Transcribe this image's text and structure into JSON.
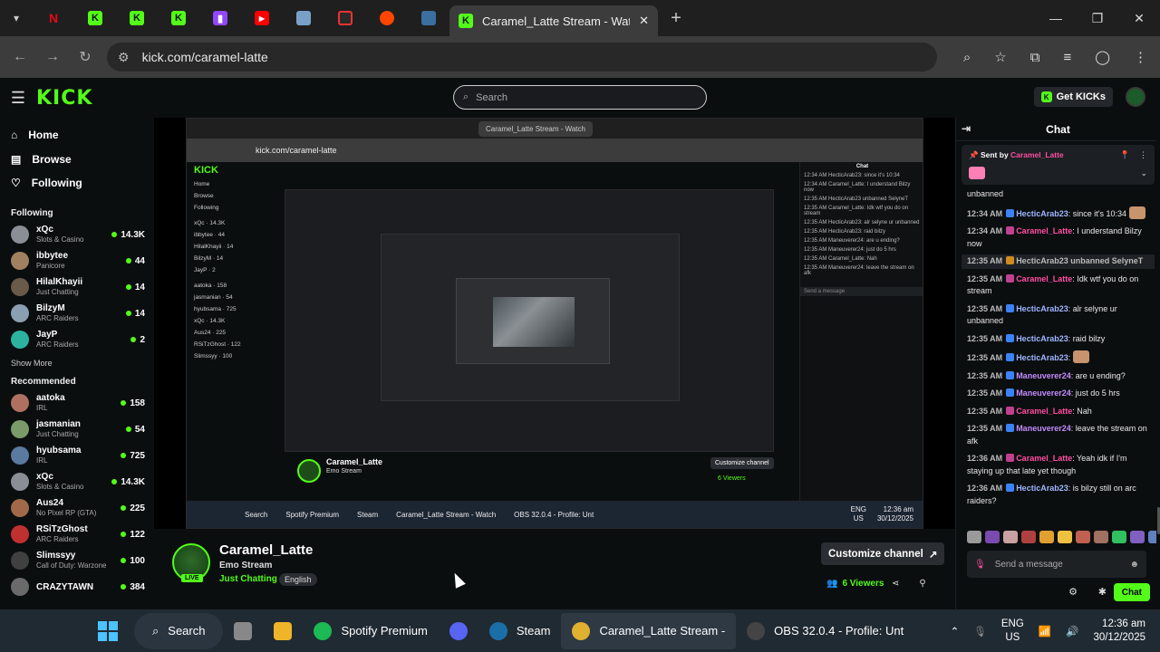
{
  "browser": {
    "active_tab_title": "Caramel_Latte Stream - Watch",
    "address": "kick.com/caramel-latte",
    "pinned_tab_icons": [
      "netflix-icon",
      "kick-icon",
      "kick-icon",
      "kick-icon",
      "twitch-icon",
      "youtube-icon",
      "site-icon",
      "site-icon",
      "reddit-icon",
      "site-icon"
    ]
  },
  "header": {
    "logo": "KICK",
    "search_placeholder": "Search",
    "get_kicks": "Get KICKs"
  },
  "sidebar": {
    "nav": [
      {
        "label": "Home",
        "icon": "home-icon"
      },
      {
        "label": "Browse",
        "icon": "compass-icon"
      },
      {
        "label": "Following",
        "icon": "heart-icon"
      }
    ],
    "following_heading": "Following",
    "following": [
      {
        "name": "xQc",
        "category": "Slots & Casino",
        "viewers": "14.3K",
        "color": "#8a8f96"
      },
      {
        "name": "ibbytee",
        "category": "Panicore",
        "viewers": "44",
        "color": "#a08060"
      },
      {
        "name": "HilalKhayii",
        "category": "Just Chatting",
        "viewers": "14",
        "color": "#6a5a4a"
      },
      {
        "name": "BilzyM",
        "category": "ARC Raiders",
        "viewers": "14",
        "color": "#8aa0b0"
      },
      {
        "name": "JayP",
        "category": "ARC Raiders",
        "viewers": "2",
        "color": "#2bb3a0"
      }
    ],
    "show_more": "Show More",
    "recommended_heading": "Recommended",
    "recommended": [
      {
        "name": "aatoka",
        "category": "IRL",
        "viewers": "158",
        "color": "#b07060"
      },
      {
        "name": "jasmanian",
        "category": "Just Chatting",
        "viewers": "54",
        "color": "#7a9a6a"
      },
      {
        "name": "hyubsama",
        "category": "IRL",
        "viewers": "725",
        "color": "#5a7aa0"
      },
      {
        "name": "xQc",
        "category": "Slots & Casino",
        "viewers": "14.3K",
        "color": "#8a8f96"
      },
      {
        "name": "Aus24",
        "category": "No Pixel RP (GTA)",
        "viewers": "225",
        "color": "#a06a4a"
      },
      {
        "name": "RSiTzGhost",
        "category": "ARC Raiders",
        "viewers": "122",
        "color": "#c03030"
      },
      {
        "name": "Slimssyy",
        "category": "Call of Duty: Warzone",
        "viewers": "100",
        "color": "#404040"
      },
      {
        "name": "CRAZYTAWN",
        "category": "",
        "viewers": "384",
        "color": "#6a6a6a"
      }
    ]
  },
  "stream": {
    "channel": "Caramel_Latte",
    "title": "Emo Stream",
    "category": "Just Chatting",
    "tag": "English",
    "live": "LIVE",
    "customize": "Customize channel",
    "viewers": "6 Viewers"
  },
  "inner": {
    "address": "kick.com/caramel-latte",
    "tab_title": "Caramel_Latte Stream - Watch",
    "channel": "Caramel_Latte",
    "title": "Emo Stream",
    "customize": "Customize channel",
    "chat_placeholder": "Send a message",
    "viewers": "6 Viewers",
    "taskbar": [
      "Search",
      "Spotify Premium",
      "Steam",
      "Caramel_Latte Stream - Watch",
      "OBS 32.0.4 - Profile: Unt"
    ],
    "clock_time": "12:36 am",
    "clock_date": "30/12/2025",
    "lang_top": "ENG",
    "lang_bottom": "US"
  },
  "chat": {
    "title": "Chat",
    "pinned_label": "Sent by",
    "pinned_user": "Caramel_Latte",
    "top_fragment": "unbanned",
    "messages": [
      {
        "ts": "12:34 AM",
        "user": "HecticArab23",
        "color": "#9fb6ff",
        "text": ": since it's 10:34",
        "emote": true,
        "sys": false
      },
      {
        "ts": "12:34 AM",
        "user": "Caramel_Latte",
        "color": "#ff4fa3",
        "text": ": I understand Bilzy now",
        "emote": false,
        "sys": false
      },
      {
        "ts": "12:35 AM",
        "user": "HecticArab23",
        "color": "#bbbbbb",
        "text": " unbanned SelyneT",
        "emote": false,
        "sys": true
      },
      {
        "ts": "12:35 AM",
        "user": "Caramel_Latte",
        "color": "#ff4fa3",
        "text": ": Idk wtf you do on stream",
        "emote": false,
        "sys": false
      },
      {
        "ts": "12:35 AM",
        "user": "HecticArab23",
        "color": "#9fb6ff",
        "text": ": alr selyne ur unbanned",
        "emote": false,
        "sys": false
      },
      {
        "ts": "12:35 AM",
        "user": "HecticArab23",
        "color": "#9fb6ff",
        "text": ": raid bilzy",
        "emote": false,
        "sys": false
      },
      {
        "ts": "12:35 AM",
        "user": "HecticArab23",
        "color": "#9fb6ff",
        "text": ":",
        "emote": true,
        "sys": false
      },
      {
        "ts": "12:35 AM",
        "user": "Maneuverer24",
        "color": "#c48cff",
        "text": ": are u ending?",
        "emote": false,
        "sys": false
      },
      {
        "ts": "12:35 AM",
        "user": "Maneuverer24",
        "color": "#c48cff",
        "text": ": just do 5 hrs",
        "emote": false,
        "sys": false
      },
      {
        "ts": "12:35 AM",
        "user": "Caramel_Latte",
        "color": "#ff4fa3",
        "text": ": Nah",
        "emote": false,
        "sys": false
      },
      {
        "ts": "12:35 AM",
        "user": "Maneuverer24",
        "color": "#c48cff",
        "text": ": leave the stream on afk",
        "emote": false,
        "sys": false
      },
      {
        "ts": "12:36 AM",
        "user": "Caramel_Latte",
        "color": "#ff4fa3",
        "text": ": Yeah idk if I'm staying up that late yet though",
        "emote": false,
        "sys": false
      },
      {
        "ts": "12:36 AM",
        "user": "HecticArab23",
        "color": "#9fb6ff",
        "text": ": is bilzy still on arc raiders?",
        "emote": false,
        "sys": false
      }
    ],
    "input_placeholder": "Send a message",
    "send_label": "Chat"
  },
  "taskbar": {
    "search": "Search",
    "apps": [
      {
        "label": "Spotify Premium",
        "color": "#1db954",
        "icon": "spotify-icon"
      },
      {
        "label": "",
        "color": "#5865f2",
        "icon": "discord-icon"
      },
      {
        "label": "Steam",
        "color": "#1b6fa8",
        "icon": "steam-icon"
      },
      {
        "label": "Caramel_Latte Stream -",
        "color": "#e0b030",
        "icon": "chrome-icon"
      },
      {
        "label": "OBS 32.0.4 - Profile: Unt",
        "color": "#444",
        "icon": "obs-icon"
      }
    ],
    "lang_top": "ENG",
    "lang_bottom": "US",
    "time": "12:36 am",
    "date": "30/12/2025"
  }
}
